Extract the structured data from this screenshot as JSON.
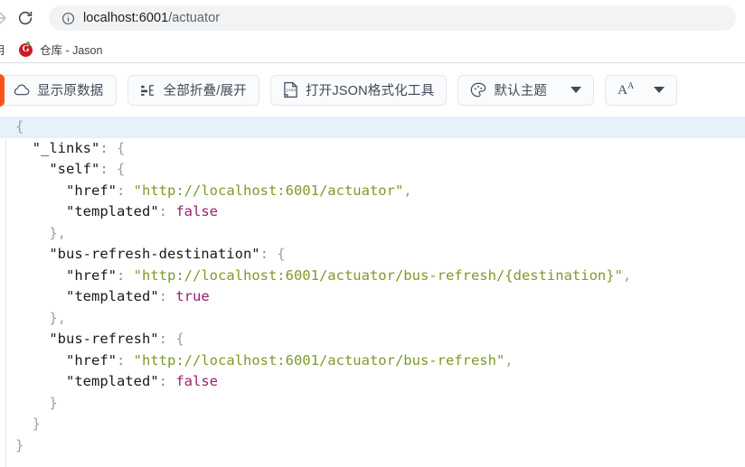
{
  "browser": {
    "nav": {
      "forward_icon": "arrow-forward-icon",
      "reload_icon": "reload-icon",
      "info_icon": "page-info-icon",
      "url_host": "localhost:6001",
      "url_path": "/actuator",
      "url_full": "localhost:6001/actuator"
    },
    "bookmarks": {
      "clipped_label": "用",
      "items": [
        {
          "icon": "gitee-icon",
          "icon_letter": "G",
          "label": "仓库 - Jason"
        }
      ]
    }
  },
  "extension_toolbar": {
    "accent_color": "#fa541c",
    "buttons": [
      {
        "icon": "cloud-icon",
        "label": "显示原数据",
        "has_caret": false
      },
      {
        "icon": "collapse-expand-icon",
        "label": "全部折叠/展开",
        "has_caret": false
      },
      {
        "icon": "json-file-icon",
        "label": "打开JSON格式化工具",
        "has_caret": false
      },
      {
        "icon": "palette-icon",
        "label": "默认主题",
        "has_caret": true
      },
      {
        "icon": "font-size-icon",
        "label": "",
        "glyph": "A",
        "glyph_sup": "A",
        "has_caret": true
      }
    ]
  },
  "json_viewer": {
    "active_line": 1,
    "colors": {
      "string": "#7d9b28",
      "boolean": "#9c1e6d",
      "key": "#1a1a1a",
      "punctuation": "#9aa0a6",
      "active_line_bg": "#e8f0fa"
    },
    "lines": [
      {
        "indent": 0,
        "parts": [
          {
            "t": "punc",
            "v": "{"
          }
        ]
      },
      {
        "indent": 1,
        "parts": [
          {
            "t": "key",
            "v": "\"_links\""
          },
          {
            "t": "colon",
            "v": ": "
          },
          {
            "t": "punc",
            "v": "{"
          }
        ]
      },
      {
        "indent": 2,
        "parts": [
          {
            "t": "key",
            "v": "\"self\""
          },
          {
            "t": "colon",
            "v": ": "
          },
          {
            "t": "punc",
            "v": "{"
          }
        ]
      },
      {
        "indent": 3,
        "parts": [
          {
            "t": "key",
            "v": "\"href\""
          },
          {
            "t": "colon",
            "v": ": "
          },
          {
            "t": "str",
            "v": "\"http://localhost:6001/actuator\""
          },
          {
            "t": "punc",
            "v": ","
          }
        ]
      },
      {
        "indent": 3,
        "parts": [
          {
            "t": "key",
            "v": "\"templated\""
          },
          {
            "t": "colon",
            "v": ": "
          },
          {
            "t": "bool",
            "v": "false"
          }
        ]
      },
      {
        "indent": 2,
        "parts": [
          {
            "t": "punc",
            "v": "},"
          }
        ]
      },
      {
        "indent": 2,
        "parts": [
          {
            "t": "key",
            "v": "\"bus-refresh-destination\""
          },
          {
            "t": "colon",
            "v": ": "
          },
          {
            "t": "punc",
            "v": "{"
          }
        ]
      },
      {
        "indent": 3,
        "parts": [
          {
            "t": "key",
            "v": "\"href\""
          },
          {
            "t": "colon",
            "v": ": "
          },
          {
            "t": "str",
            "v": "\"http://localhost:6001/actuator/bus-refresh/{destination}\""
          },
          {
            "t": "punc",
            "v": ","
          }
        ]
      },
      {
        "indent": 3,
        "parts": [
          {
            "t": "key",
            "v": "\"templated\""
          },
          {
            "t": "colon",
            "v": ": "
          },
          {
            "t": "bool",
            "v": "true"
          }
        ]
      },
      {
        "indent": 2,
        "parts": [
          {
            "t": "punc",
            "v": "},"
          }
        ]
      },
      {
        "indent": 2,
        "parts": [
          {
            "t": "key",
            "v": "\"bus-refresh\""
          },
          {
            "t": "colon",
            "v": ": "
          },
          {
            "t": "punc",
            "v": "{"
          }
        ]
      },
      {
        "indent": 3,
        "parts": [
          {
            "t": "key",
            "v": "\"href\""
          },
          {
            "t": "colon",
            "v": ": "
          },
          {
            "t": "str",
            "v": "\"http://localhost:6001/actuator/bus-refresh\""
          },
          {
            "t": "punc",
            "v": ","
          }
        ]
      },
      {
        "indent": 3,
        "parts": [
          {
            "t": "key",
            "v": "\"templated\""
          },
          {
            "t": "colon",
            "v": ": "
          },
          {
            "t": "bool",
            "v": "false"
          }
        ]
      },
      {
        "indent": 2,
        "parts": [
          {
            "t": "punc",
            "v": "}"
          }
        ]
      },
      {
        "indent": 1,
        "parts": [
          {
            "t": "punc",
            "v": "}"
          }
        ]
      },
      {
        "indent": 0,
        "parts": [
          {
            "t": "punc",
            "v": "}"
          }
        ]
      }
    ]
  }
}
